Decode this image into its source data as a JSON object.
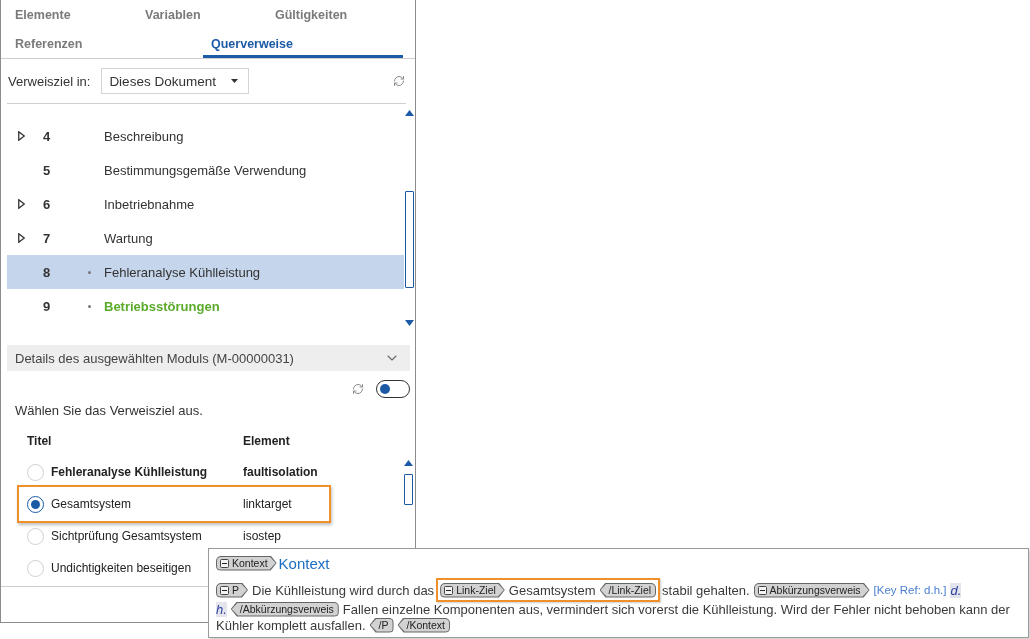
{
  "tab_rows": [
    [
      {
        "label": "Elemente",
        "selected": false
      },
      {
        "label": "Variablen",
        "selected": false
      },
      {
        "label": "Gültigkeiten",
        "selected": false
      }
    ],
    [
      {
        "label": "Referenzen",
        "selected": false
      },
      {
        "label": "Querverweise",
        "selected": true
      }
    ]
  ],
  "target_filter": {
    "label": "Verweisziel in:",
    "value": "Dieses Dokument"
  },
  "tree": {
    "rows": [
      {
        "number": "4",
        "title": "Beschreibung",
        "expandable": true,
        "bullet": false,
        "selected": false,
        "highlighted": false
      },
      {
        "number": "5",
        "title": "Bestimmungsgemäße Verwendung",
        "expandable": false,
        "bullet": false,
        "selected": false,
        "highlighted": false
      },
      {
        "number": "6",
        "title": "Inbetriebnahme",
        "expandable": true,
        "bullet": false,
        "selected": false,
        "highlighted": false
      },
      {
        "number": "7",
        "title": "Wartung",
        "expandable": true,
        "bullet": false,
        "selected": false,
        "highlighted": false
      },
      {
        "number": "8",
        "title": "Fehleranalyse Kühlleistung",
        "expandable": false,
        "bullet": true,
        "selected": true,
        "highlighted": false
      },
      {
        "number": "9",
        "title": "Betriebsstörungen",
        "expandable": false,
        "bullet": true,
        "selected": false,
        "highlighted": true
      }
    ]
  },
  "details": {
    "title": "Details des ausgewählten Moduls (M-00000031)",
    "expanded": true
  },
  "toggle": {
    "on": false
  },
  "instruction": "Wählen Sie das Verweisziel aus.",
  "targets": {
    "columns": [
      "Titel",
      "Element"
    ],
    "rows": [
      {
        "title": "Fehleranalyse Kühlleistung",
        "element": "faultisolation",
        "selected": false,
        "emphasized": true,
        "highlighted": false
      },
      {
        "title": "Gesamtsystem",
        "element": "linktarget",
        "selected": true,
        "emphasized": false,
        "highlighted": true
      },
      {
        "title": "Sichtprüfung Gesamtsystem",
        "element": "isostep",
        "selected": false,
        "emphasized": false,
        "highlighted": false
      },
      {
        "title": "Undichtigkeiten beseitigen",
        "selected": false,
        "emphasized": false,
        "highlighted": false
      }
    ]
  },
  "editor": {
    "heading": {
      "tag": "Kontext",
      "text": "Kontext"
    },
    "lines": [
      [
        {
          "kind": "start_tag",
          "label": "P"
        },
        {
          "kind": "text",
          "text": "Die Kühlleistung wird durch das"
        },
        {
          "kind": "highlight",
          "segments": [
            {
              "kind": "start_tag",
              "label": "Link-Ziel"
            },
            {
              "kind": "text",
              "text": "Gesamtsystem"
            },
            {
              "kind": "end_tag",
              "label": "/Link-Ziel"
            }
          ]
        },
        {
          "kind": "text",
          "text": "stabil gehalten."
        },
        {
          "kind": "start_tag",
          "label": "Abkürzungsverweis"
        },
        {
          "kind": "key_ref",
          "text": "[Key Ref: d.h.]"
        },
        {
          "kind": "abbreviation",
          "text": "d."
        }
      ],
      [
        {
          "kind": "abbreviation",
          "text": "h."
        },
        {
          "kind": "end_tag",
          "label": "/Abkürzungsverweis"
        },
        {
          "kind": "text",
          "text": "Fallen einzelne Komponenten aus, vermindert sich vorerst die Kühlleistung. Wird der Fehler nicht behoben kann der"
        }
      ],
      [
        {
          "kind": "text",
          "text": "Kühler komplett ausfallen."
        },
        {
          "kind": "end_tag",
          "label": "/P"
        },
        {
          "kind": "end_tag",
          "label": "/Kontext"
        }
      ]
    ]
  }
}
